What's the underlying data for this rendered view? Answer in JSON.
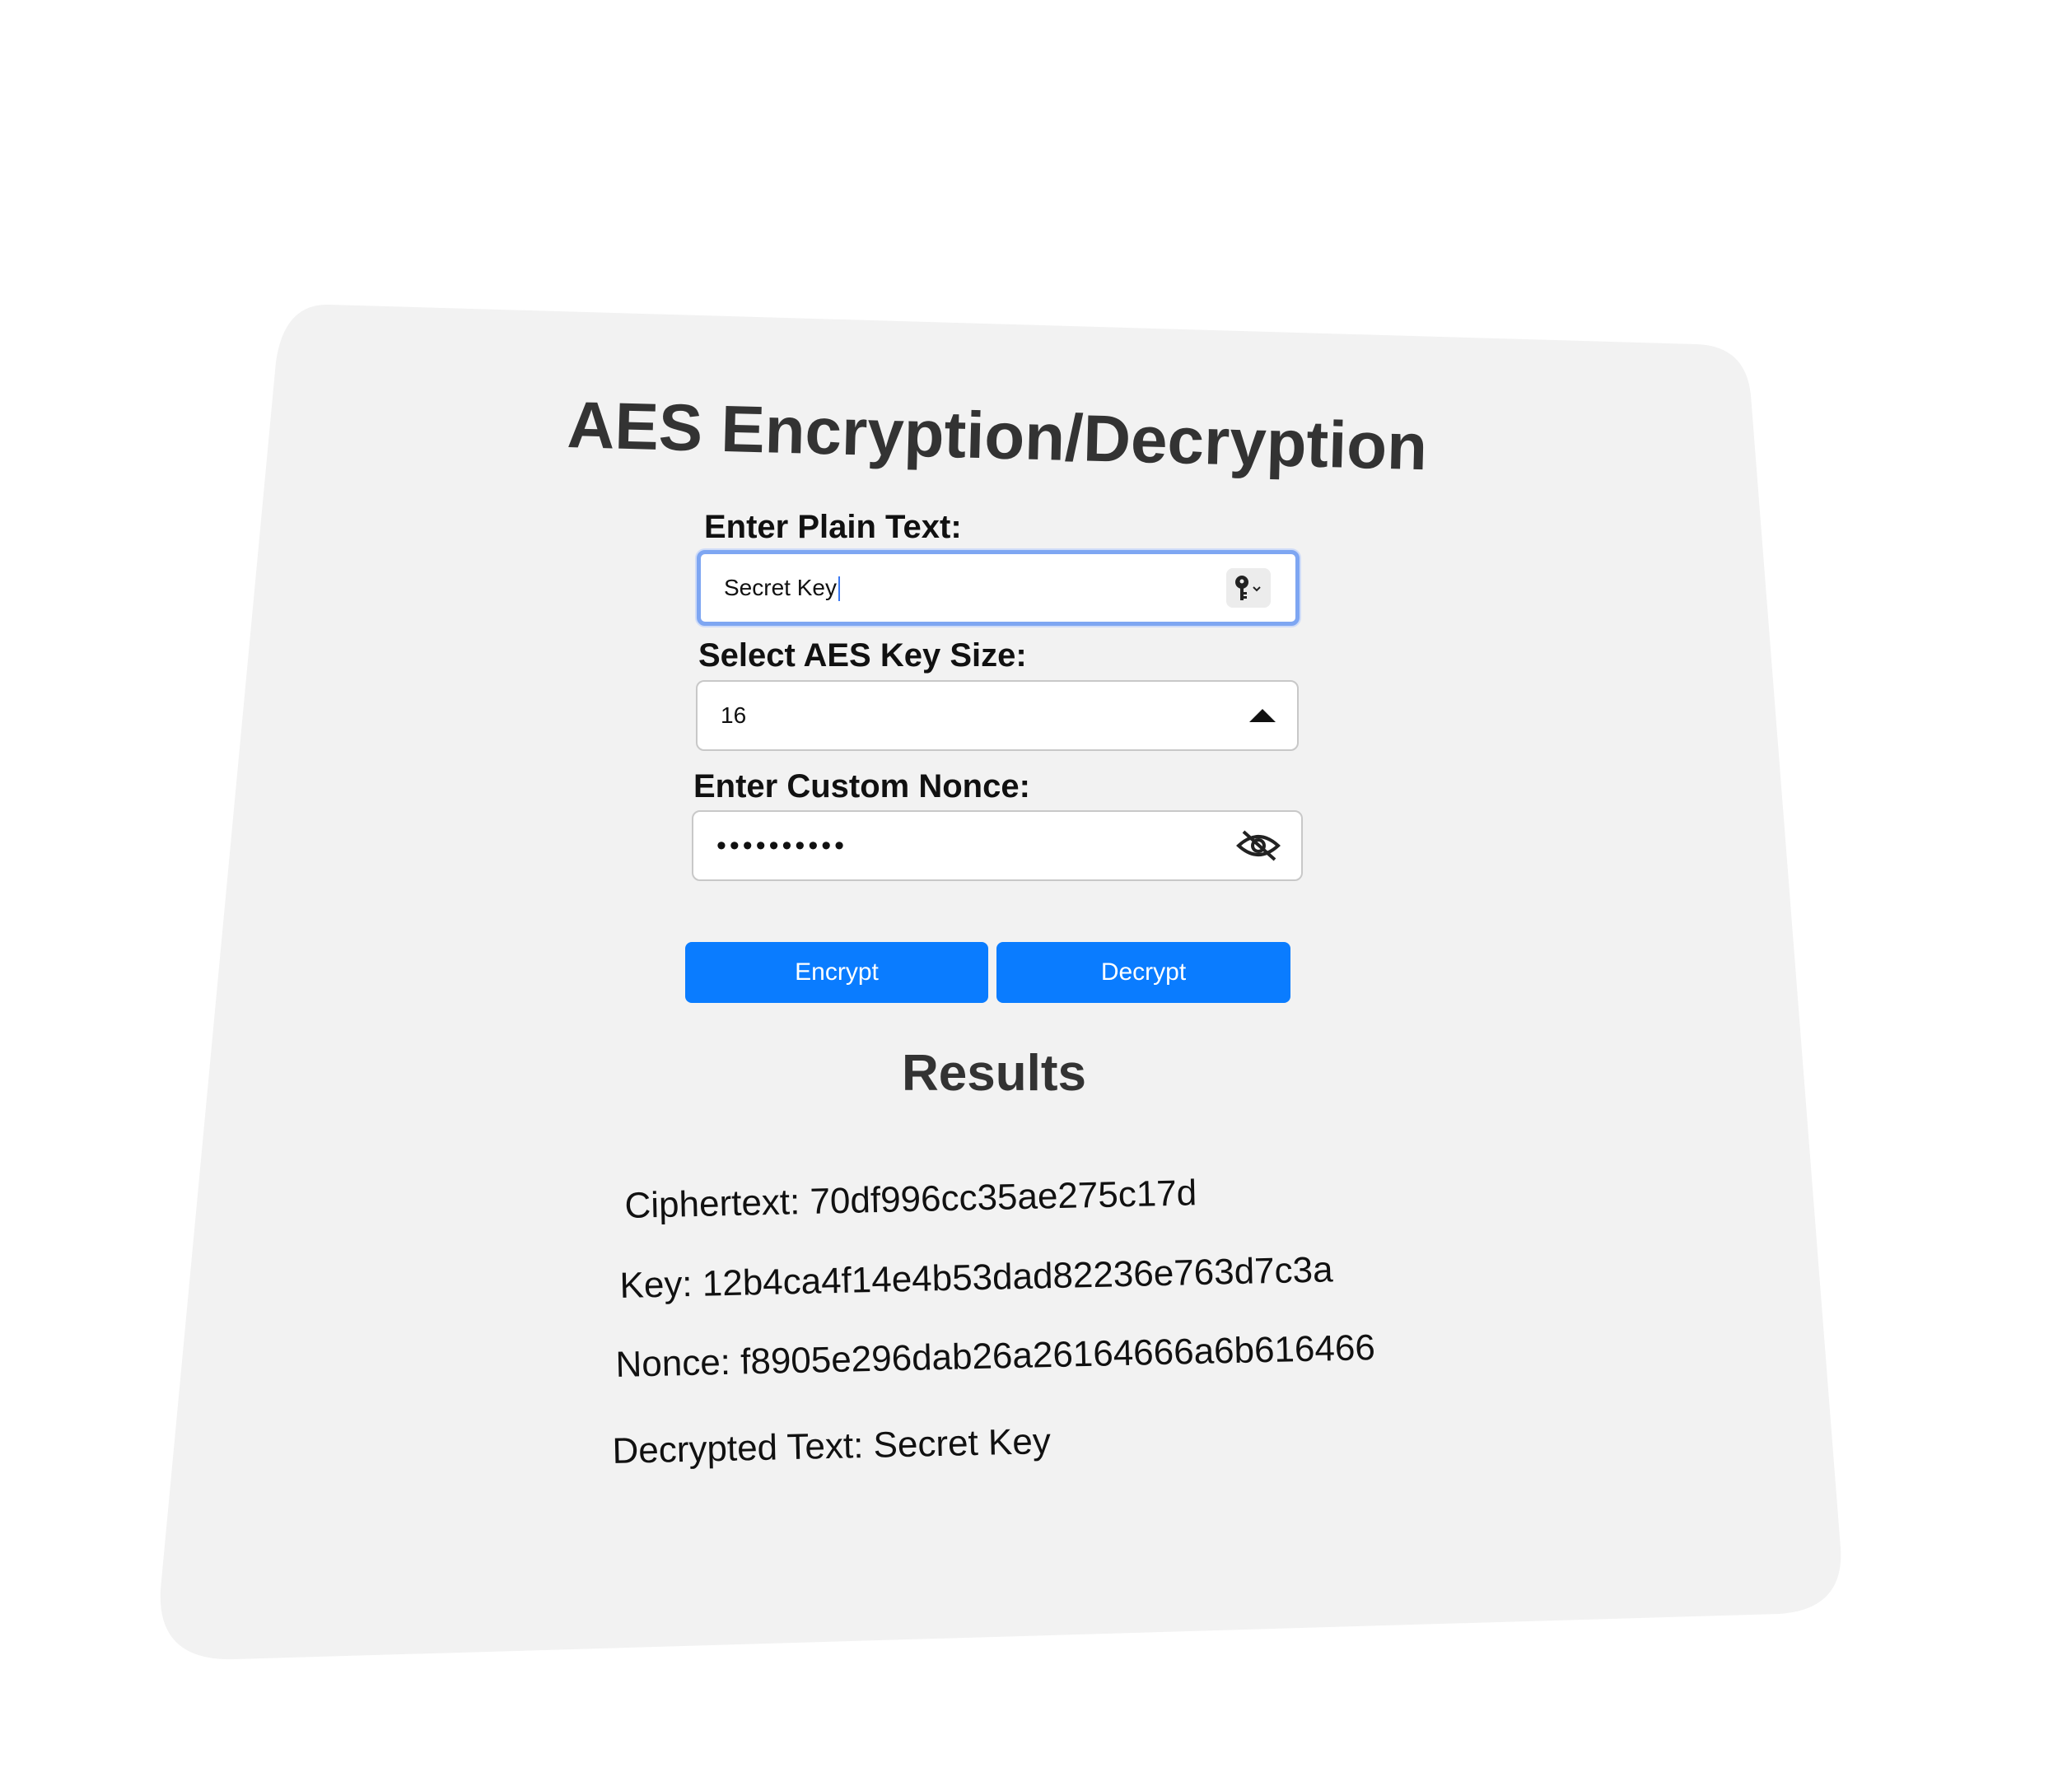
{
  "title": "AES Encryption/Decryption",
  "form": {
    "plain_text_label": "Enter Plain Text:",
    "plain_text_value": "Secret Key",
    "key_size_label": "Select AES Key Size:",
    "key_size_value": "16",
    "nonce_label": "Enter Custom Nonce:",
    "nonce_masked": "••••••••••"
  },
  "buttons": {
    "encrypt_label": "Encrypt",
    "decrypt_label": "Decrypt"
  },
  "results": {
    "heading": "Results",
    "ciphertext_label": "Ciphertext:",
    "ciphertext_value": "70df996cc35ae275c17d",
    "key_label": "Key:",
    "key_value": "12b4ca4f14e4b53dad82236e763d7c3a",
    "nonce_label": "Nonce:",
    "nonce_value": "f8905e296dab26a26164666a6b616466",
    "decrypted_label": "Decrypted Text:",
    "decrypted_value": "Secret Key"
  },
  "colors": {
    "card_background": "#f2f2f2",
    "button_blue": "#0a7cff",
    "focus_ring": "#7ea6f2",
    "title_text": "#333333"
  },
  "icons": {
    "password_manager": "key-icon",
    "select_arrow": "caret-up-icon",
    "visibility_toggle": "eye-slash-icon"
  }
}
